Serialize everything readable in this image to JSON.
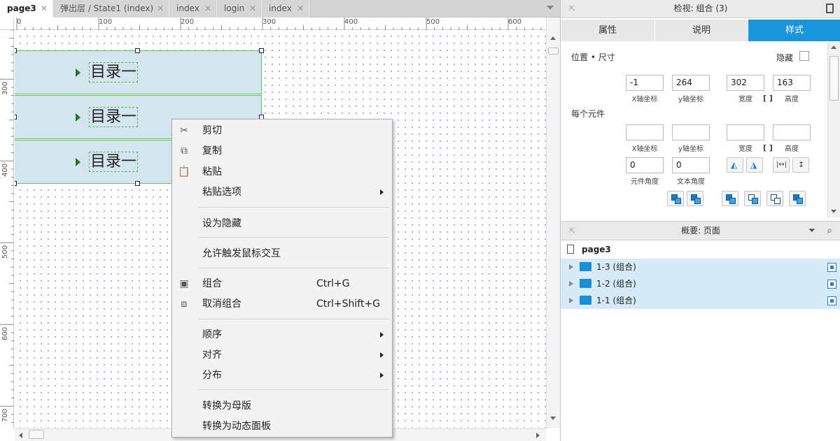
{
  "tabs": [
    {
      "label": "page3",
      "active": true
    },
    {
      "label": "弹出层 / State1 (index)",
      "active": false
    },
    {
      "label": "index",
      "active": false
    },
    {
      "label": "login",
      "active": false
    },
    {
      "label": "index",
      "active": false
    }
  ],
  "ruler": {
    "h_labels": [
      "0",
      "100",
      "200",
      "300",
      "400",
      "500",
      "600"
    ],
    "v_labels": [
      "300",
      "400",
      "500",
      "600",
      "700"
    ]
  },
  "canvas": {
    "rows": [
      {
        "label": "目录一"
      },
      {
        "label": "目录一"
      },
      {
        "label": "目录一"
      }
    ]
  },
  "context_menu": {
    "items": [
      {
        "label": "剪切",
        "icon": "scissors-icon"
      },
      {
        "label": "复制",
        "icon": "copy-icon"
      },
      {
        "label": "粘贴",
        "icon": "paste-icon"
      },
      {
        "label": "粘贴选项",
        "submenu": true
      },
      {
        "label": "设为隐藏"
      },
      {
        "label": "允许触发鼠标交互"
      },
      {
        "label": "组合",
        "shortcut": "Ctrl+G",
        "icon": "group-icon"
      },
      {
        "label": "取消组合",
        "shortcut": "Ctrl+Shift+G",
        "icon": "ungroup-icon"
      },
      {
        "label": "顺序",
        "submenu": true
      },
      {
        "label": "对齐",
        "submenu": true
      },
      {
        "label": "分布",
        "submenu": true
      },
      {
        "label": "转换为母版"
      },
      {
        "label": "转换为动态面板"
      }
    ]
  },
  "inspector": {
    "title": "检视: 组合 (3)",
    "tabs": [
      "属性",
      "说明",
      "样式"
    ],
    "active_tab": "样式",
    "section_position": "位置 • 尺寸",
    "hidden_label": "隐藏",
    "x": "-1",
    "y": "264",
    "width": "302",
    "height": "163",
    "x_label": "X轴坐标",
    "y_label": "y轴坐标",
    "width_label": "宽度",
    "height_label": "高度",
    "each_element": "每个元件",
    "each_x_label": "X轴坐标",
    "each_y_label": "y轴坐标",
    "each_width_label": "宽度",
    "each_height_label": "高度",
    "element_angle": "0",
    "text_angle": "0",
    "element_angle_label": "元件角度",
    "text_angle_label": "文本角度"
  },
  "outline": {
    "title": "概要: 页面",
    "page": "page3",
    "items": [
      {
        "label": "1-3 (组合)"
      },
      {
        "label": "1-2 (组合)"
      },
      {
        "label": "1-1 (组合)"
      }
    ]
  },
  "colors": {
    "accent": "#1a95db",
    "selection_fill": "#d4e5ef",
    "selection_border": "#5cc85c"
  }
}
